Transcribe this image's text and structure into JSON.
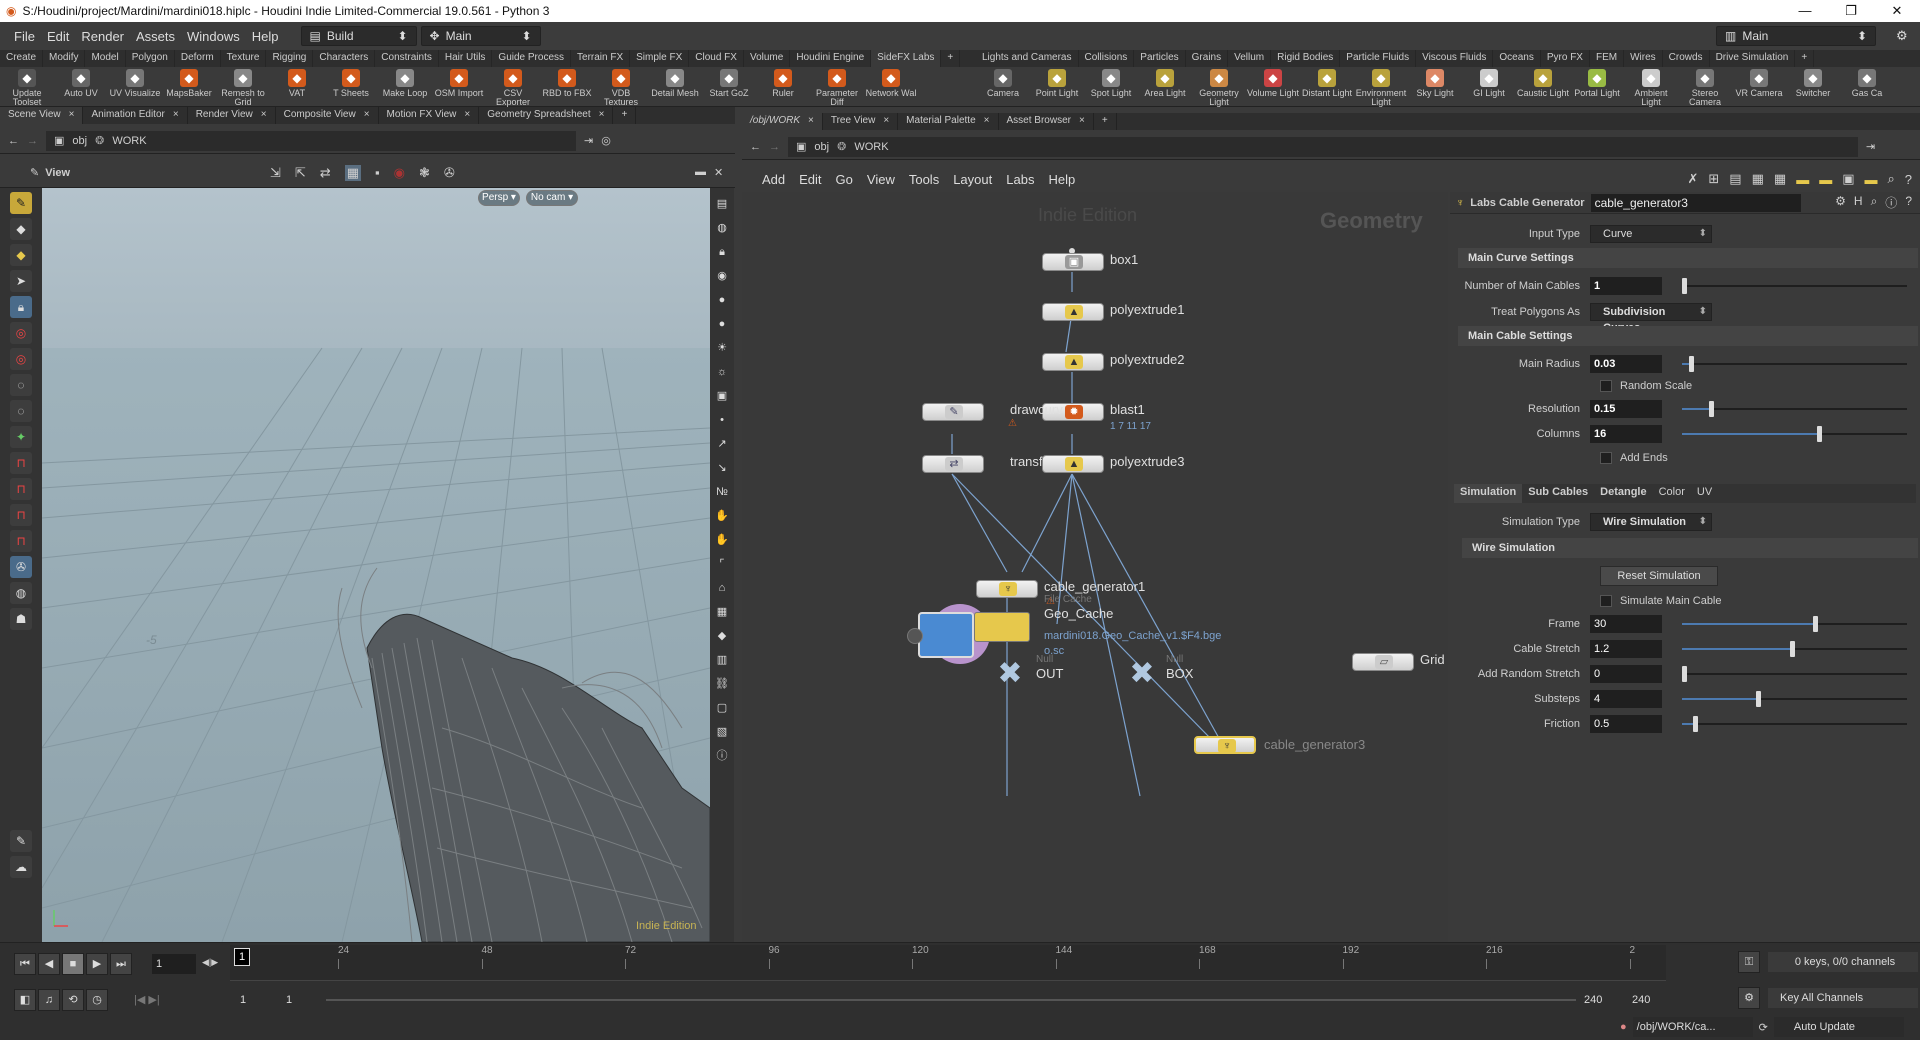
{
  "window": {
    "title": "S:/Houdini/project/Mardini/mardini018.hiplc - Houdini Indie Limited-Commercial 19.0.561 - Python 3",
    "minimize": "—",
    "maximize": "❐",
    "close": "✕"
  },
  "menu": {
    "items": [
      "File",
      "Edit",
      "Render",
      "Assets",
      "Windows",
      "Help"
    ],
    "desktop": "Build",
    "context": "Main",
    "right_desktop": "Main"
  },
  "shelf_tabs_left": [
    "Create",
    "Modify",
    "Model",
    "Polygon",
    "Deform",
    "Texture",
    "Rigging",
    "Characters",
    "Constraints",
    "Hair Utils",
    "Guide Process",
    "Terrain FX",
    "Simple FX",
    "Cloud FX",
    "Volume",
    "Houdini Engine",
    "SideFX Labs"
  ],
  "shelf_tabs_right": [
    "Lights and Cameras",
    "Collisions",
    "Particles",
    "Grains",
    "Vellum",
    "Rigid Bodies",
    "Particle Fluids",
    "Viscous Fluids",
    "Oceans",
    "Pyro FX",
    "FEM",
    "Wires",
    "Crowds",
    "Drive Simulation"
  ],
  "shelf_tools_left": [
    {
      "label": "Update Toolset",
      "icon": "update-icon",
      "color": "#555"
    },
    {
      "label": "Auto UV",
      "icon": "checker-icon",
      "color": "#666"
    },
    {
      "label": "UV Visualize",
      "icon": "uv-icon",
      "color": "#777"
    },
    {
      "label": "MapsBaker",
      "icon": "baker-icon",
      "color": "#d35a1c"
    },
    {
      "label": "Remesh to Grid",
      "icon": "remesh-icon",
      "color": "#888"
    },
    {
      "label": "VAT",
      "icon": "vat-icon",
      "color": "#d35a1c"
    },
    {
      "label": "T Sheets",
      "icon": "tsheets-icon",
      "color": "#d35a1c"
    },
    {
      "label": "Make Loop",
      "icon": "loop-icon",
      "color": "#888"
    },
    {
      "label": "OSM Import",
      "icon": "osm-icon",
      "color": "#d35a1c"
    },
    {
      "label": "CSV Exporter",
      "icon": "csv-icon",
      "color": "#d35a1c"
    },
    {
      "label": "RBD to FBX",
      "icon": "rbd-icon",
      "color": "#d35a1c"
    },
    {
      "label": "VDB Textures",
      "icon": "vdb-icon",
      "color": "#d35a1c"
    },
    {
      "label": "Detail Mesh",
      "icon": "detail-icon",
      "color": "#888"
    },
    {
      "label": "Start GoZ",
      "icon": "goz-icon",
      "color": "#777"
    },
    {
      "label": "Ruler",
      "icon": "ruler-icon",
      "color": "#d35a1c"
    },
    {
      "label": "Parameter Diff",
      "icon": "diff-icon",
      "color": "#d35a1c"
    },
    {
      "label": "Network Wal",
      "icon": "network-icon",
      "color": "#d35a1c"
    }
  ],
  "shelf_tools_right": [
    {
      "label": "Camera",
      "icon": "camera-icon",
      "color": "#666"
    },
    {
      "label": "Point Light",
      "icon": "point-light-icon",
      "color": "#b9a23c"
    },
    {
      "label": "Spot Light",
      "icon": "spot-light-icon",
      "color": "#888"
    },
    {
      "label": "Area Light",
      "icon": "area-light-icon",
      "color": "#b9a23c"
    },
    {
      "label": "Geometry Light",
      "icon": "geometry-light-icon",
      "color": "#c84"
    },
    {
      "label": "Volume Light",
      "icon": "volume-light-icon",
      "color": "#c44"
    },
    {
      "label": "Distant Light",
      "icon": "distant-light-icon",
      "color": "#b9a23c"
    },
    {
      "label": "Environment Light",
      "icon": "environment-light-icon",
      "color": "#b9a23c"
    },
    {
      "label": "Sky Light",
      "icon": "sky-light-icon",
      "color": "#d86"
    },
    {
      "label": "GI Light",
      "icon": "gi-light-icon",
      "color": "#ccc"
    },
    {
      "label": "Caustic Light",
      "icon": "caustic-light-icon",
      "color": "#b9a23c"
    },
    {
      "label": "Portal Light",
      "icon": "portal-light-icon",
      "color": "#9b4"
    },
    {
      "label": "Ambient Light",
      "icon": "ambient-light-icon",
      "color": "#ccc"
    },
    {
      "label": "Stereo Camera",
      "icon": "stereo-camera-icon",
      "color": "#777"
    },
    {
      "label": "VR Camera",
      "icon": "vr-camera-icon",
      "color": "#777"
    },
    {
      "label": "Switcher",
      "icon": "switcher-icon",
      "color": "#888"
    },
    {
      "label": "Gas Ca",
      "icon": "gas-icon",
      "color": "#777"
    }
  ],
  "left_pane": {
    "tabs": [
      "Scene View",
      "Animation Editor",
      "Render View",
      "Composite View",
      "Motion FX View",
      "Geometry Spreadsheet"
    ],
    "path_root": "obj",
    "path_node": "WORK",
    "view_label": "View",
    "persp": "Persp ▾",
    "cam": "No cam ▾",
    "watermark": "Indie Edition",
    "grid_label": "-5"
  },
  "right_pane": {
    "tabs": [
      "/obj/WORK",
      "Tree View",
      "Material Palette",
      "Asset Browser"
    ],
    "path_root": "obj",
    "path_node": "WORK",
    "menu": [
      "Add",
      "Edit",
      "Go",
      "View",
      "Tools",
      "Layout",
      "Labs",
      "Help"
    ],
    "watermark": "Indie Edition",
    "context_label": "Geometry"
  },
  "nodes": {
    "box1": "box1",
    "polyextrude1": "polyextrude1",
    "polyextrude2": "polyextrude2",
    "blast1": "blast1",
    "blast1_group": "1 7 11 17",
    "drawcurve": "drawcurv",
    "transform": "transform",
    "polyextrude3": "polyextrude3",
    "cable_generator1": "cable_generator1",
    "filecache_type": "File Cache",
    "filecache_name": "Geo_Cache",
    "filecache_path": "mardini018.Geo_Cache_v1.$F4.bge",
    "filecache_path2": "o.sc",
    "cable_generator3": "cable_generator3",
    "out_type": "Null",
    "out_name": "OUT",
    "box_type": "Null",
    "box_name": "BOX",
    "grid": "Grid"
  },
  "params": {
    "node_type": "Labs Cable Generator",
    "node_name": "cable_generator3",
    "input_type_label": "Input Type",
    "input_type": "Curve",
    "main_curve_section": "Main Curve Settings",
    "num_cables_label": "Number of Main Cables",
    "num_cables": "1",
    "num_cables_frac": 0.0,
    "treat_polys_label": "Treat Polygons As",
    "treat_polys": "Subdivision Curves",
    "main_cable_section": "Main Cable Settings",
    "main_radius_label": "Main Radius",
    "main_radius": "0.03",
    "main_radius_frac": 0.03,
    "random_scale": "Random Scale",
    "resolution_label": "Resolution",
    "resolution": "0.15",
    "resolution_frac": 0.12,
    "columns_label": "Columns",
    "columns": "16",
    "columns_frac": 0.6,
    "add_ends": "Add Ends",
    "tabs": [
      "Simulation",
      "Sub Cables",
      "Detangle",
      "Color",
      "UV"
    ],
    "sim_type_label": "Simulation Type",
    "sim_type": "Wire Simulation",
    "wire_sim_section": "Wire Simulation",
    "reset_sim": "Reset Simulation",
    "simulate_main": "Simulate Main Cable",
    "frame_label": "Frame",
    "frame": "30",
    "frame_frac": 0.58,
    "stretch_label": "Cable Stretch",
    "stretch": "1.2",
    "stretch_frac": 0.48,
    "rand_stretch_label": "Add Random Stretch",
    "rand_stretch": "0",
    "rand_stretch_frac": 0.0,
    "substeps_label": "Substeps",
    "substeps": "4",
    "substeps_frac": 0.33,
    "friction_label": "Friction",
    "friction": "0.5",
    "friction_frac": 0.05
  },
  "timeline": {
    "current_frame": "1",
    "ticks": [
      "24",
      "48",
      "72",
      "96",
      "120",
      "144",
      "168",
      "192",
      "216",
      "2"
    ],
    "range_start": "1",
    "range_start2": "1",
    "range_end": "240",
    "range_end2": "240",
    "keys_label": "0 keys, 0/0 channels",
    "key_all": "Key All Channels",
    "status_path": "/obj/WORK/ca...",
    "auto_update": "Auto Update",
    "frame_marker": "1"
  }
}
